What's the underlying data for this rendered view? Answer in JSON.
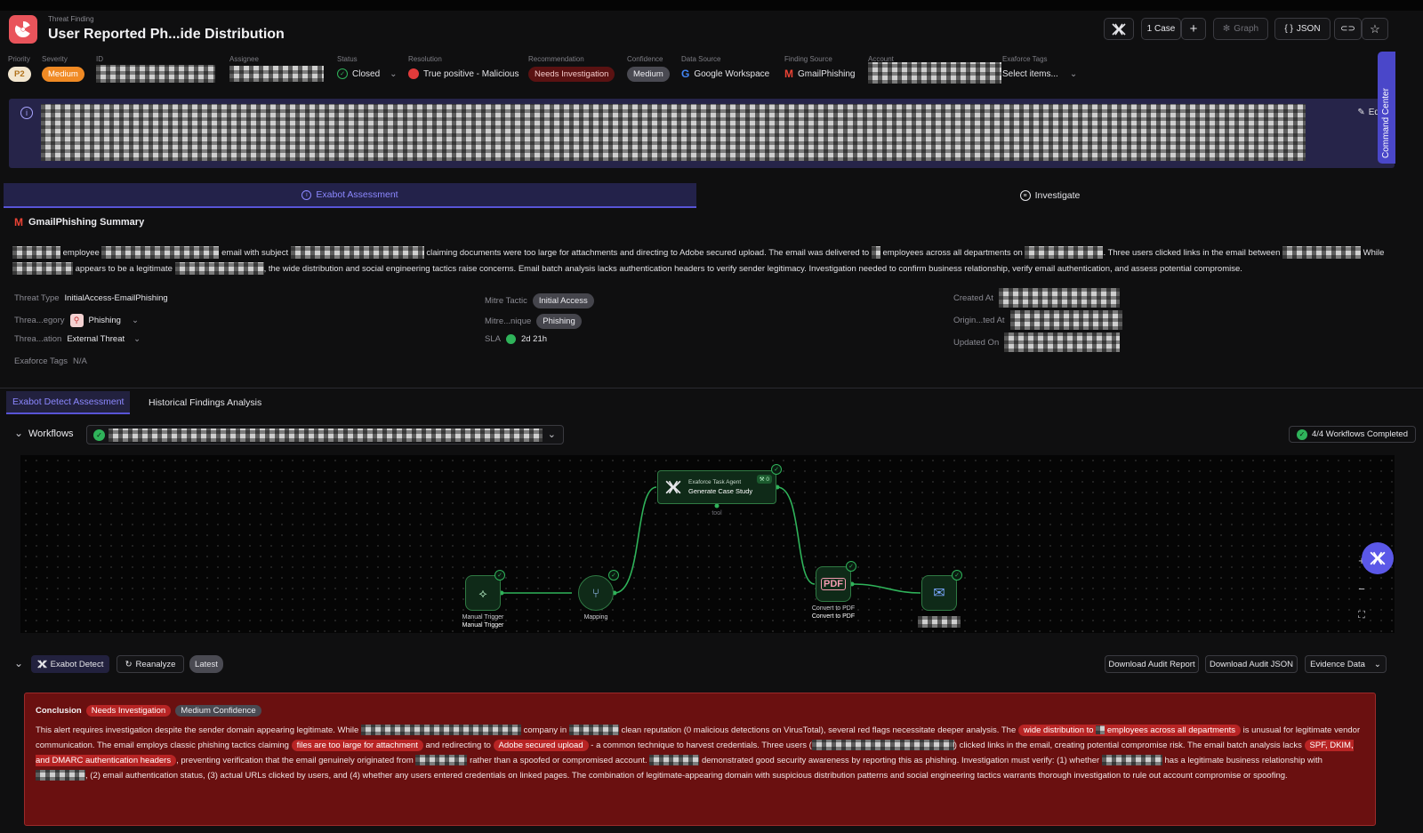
{
  "header": {
    "kicker": "Threat Finding",
    "title": "User Reported Ph...ide Distribution",
    "case_label": "1 Case",
    "graph_label": "Graph",
    "json_label": "JSON"
  },
  "meta": {
    "priority": {
      "label": "Priority",
      "value": "P2"
    },
    "severity": {
      "label": "Severity",
      "value": "Medium"
    },
    "id": {
      "label": "ID"
    },
    "assignee": {
      "label": "Assignee"
    },
    "status": {
      "label": "Status",
      "value": "Closed"
    },
    "resolution": {
      "label": "Resolution",
      "value": "True positive - Malicious"
    },
    "recommendation": {
      "label": "Recommendation",
      "value": "Needs Investigation"
    },
    "confidence": {
      "label": "Confidence",
      "value": "Medium"
    },
    "data_source": {
      "label": "Data Source",
      "value": "Google Workspace"
    },
    "finding_source": {
      "label": "Finding Source",
      "value": "GmailPhishing"
    },
    "account": {
      "label": "Account"
    },
    "tags": {
      "label": "Exaforce Tags",
      "placeholder": "Select items..."
    }
  },
  "banner": {
    "edit_label": "Edit"
  },
  "command_center": "Command Center",
  "tabs": {
    "assessment": "Exabot Assessment",
    "investigate": "Investigate"
  },
  "summary": {
    "title": "GmailPhishing Summary",
    "t1": "employee",
    "t2": "email with subject",
    "t3": "claiming documents were too large for attachments and directing to Adobe secured upload. The email was delivered to",
    "t4": "employees across all departments on",
    "t5": ". Three users clicked links in the email between",
    "t6": "While",
    "t7": "appears to be a legitimate",
    "t8": ", the wide distribution and social engineering tactics raise concerns. Email batch analysis lacks authentication headers to verify sender legitimacy. Investigation needed to confirm business relationship, verify email authentication, and assess potential compromise."
  },
  "facts": {
    "threat_type": {
      "k": "Threat Type",
      "v": "InitialAccess-EmailPhishing"
    },
    "threat_category": {
      "k": "Threa...egory",
      "v": "Phishing"
    },
    "threat_classification": {
      "k": "Threa...ation",
      "v": "External Threat"
    },
    "exaforce_tags": {
      "k": "Exaforce Tags",
      "v": "N/A"
    },
    "mitre_tactic": {
      "k": "Mitre Tactic",
      "v": "Initial Access"
    },
    "mitre_technique": {
      "k": "Mitre...nique",
      "v": "Phishing"
    },
    "sla": {
      "k": "SLA",
      "v": "2d 21h"
    },
    "created_at": {
      "k": "Created At"
    },
    "originated_at": {
      "k": "Origin...ted At"
    },
    "updated_on": {
      "k": "Updated On"
    }
  },
  "detect_tabs": {
    "active": "Exabot Detect Assessment",
    "inactive": "Historical Findings Analysis"
  },
  "workflows": {
    "label": "Workflows",
    "completed": "4/4 Workflows Completed"
  },
  "graph": {
    "nodes": {
      "manual_trigger": {
        "caption1": "Manual Trigger",
        "caption2": "Manual Trigger"
      },
      "mapping": {
        "caption1": "Mapping"
      },
      "task_agent": {
        "kicker": "Exaforce Task Agent",
        "title": "Generate Case Study",
        "badge": "0",
        "tool": "tool"
      },
      "convert_pdf": {
        "caption1": "Convert to PDF",
        "caption2": "Convert to PDF"
      }
    }
  },
  "detect_toolbar": {
    "exabot_detect": "Exabot Detect",
    "reanalyze": "Reanalyze",
    "latest": "Latest",
    "download_report": "Download Audit Report",
    "download_json": "Download Audit JSON",
    "evidence": "Evidence Data"
  },
  "conclusion": {
    "title": "Conclusion",
    "badge1": "Needs Investigation",
    "badge2": "Medium Confidence",
    "c1": "This alert requires investigation despite the sender domain appearing legitimate. While",
    "c2": "company in",
    "c3": "clean reputation (0 malicious detections on VirusTotal), several red flags necessitate deeper analysis. The",
    "h1a": "wide distribution to",
    "h1b": "employees across all departments",
    "c4": "is unusual for legitimate vendor communication. The email employs classic phishing tactics claiming",
    "h2": "files are too large for attachment",
    "c5": "and redirecting to",
    "h3": "Adobe secured upload",
    "c6": "- a common technique to harvest credentials. Three users (",
    "c7": ") clicked links in the email, creating potential compromise risk. The email batch analysis lacks",
    "h4": "SPF, DKIM, and DMARC authentication headers",
    "c8": ", preventing verification that the email genuinely originated from",
    "c9": "rather than a spoofed or compromised account.",
    "c10": "demonstrated good security awareness by reporting this as phishing. Investigation must verify: (1) whether",
    "c11": "has a legitimate business relationship with",
    "c12": ", (2) email authentication status, (3) actual URLs clicked by users, and (4) whether any users entered credentials on linked pages. The combination of legitimate-appearing domain with suspicious distribution patterns and social engineering tactics warrants thorough investigation to rule out account compromise or spoofing."
  },
  "colors": {
    "accent": "#5854d6",
    "success": "#2fb35a",
    "danger": "#b82424",
    "severity": "#f08a24"
  }
}
